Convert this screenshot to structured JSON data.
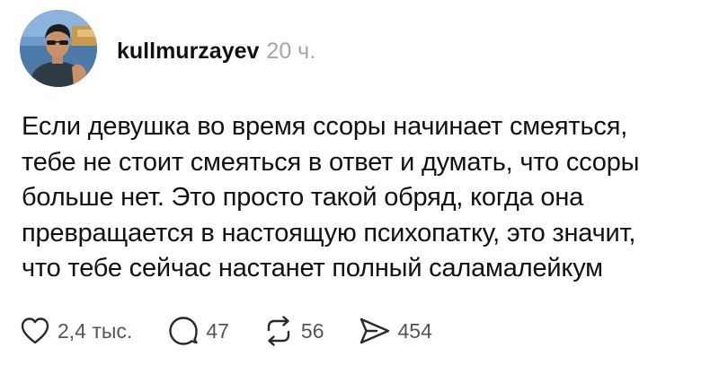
{
  "post": {
    "author": {
      "username": "kullmurzayev",
      "time": "20 ч."
    },
    "text_lines": [
      "Если девушка во время ссоры начинает смеяться,",
      "тебе не стоит смеяться в ответ и думать, что ссоры",
      "больше нет. Это просто такой обряд, когда она",
      "превращается в настоящую психопатку, это значит,",
      "что тебе сейчас настанет полный саламалейкум"
    ],
    "actions": {
      "likes": {
        "icon": "heart-icon",
        "count": "2,4 тыс."
      },
      "replies": {
        "icon": "comment-icon",
        "count": "47"
      },
      "reposts": {
        "icon": "repost-icon",
        "count": "56"
      },
      "shares": {
        "icon": "share-icon",
        "count": "454"
      }
    }
  }
}
